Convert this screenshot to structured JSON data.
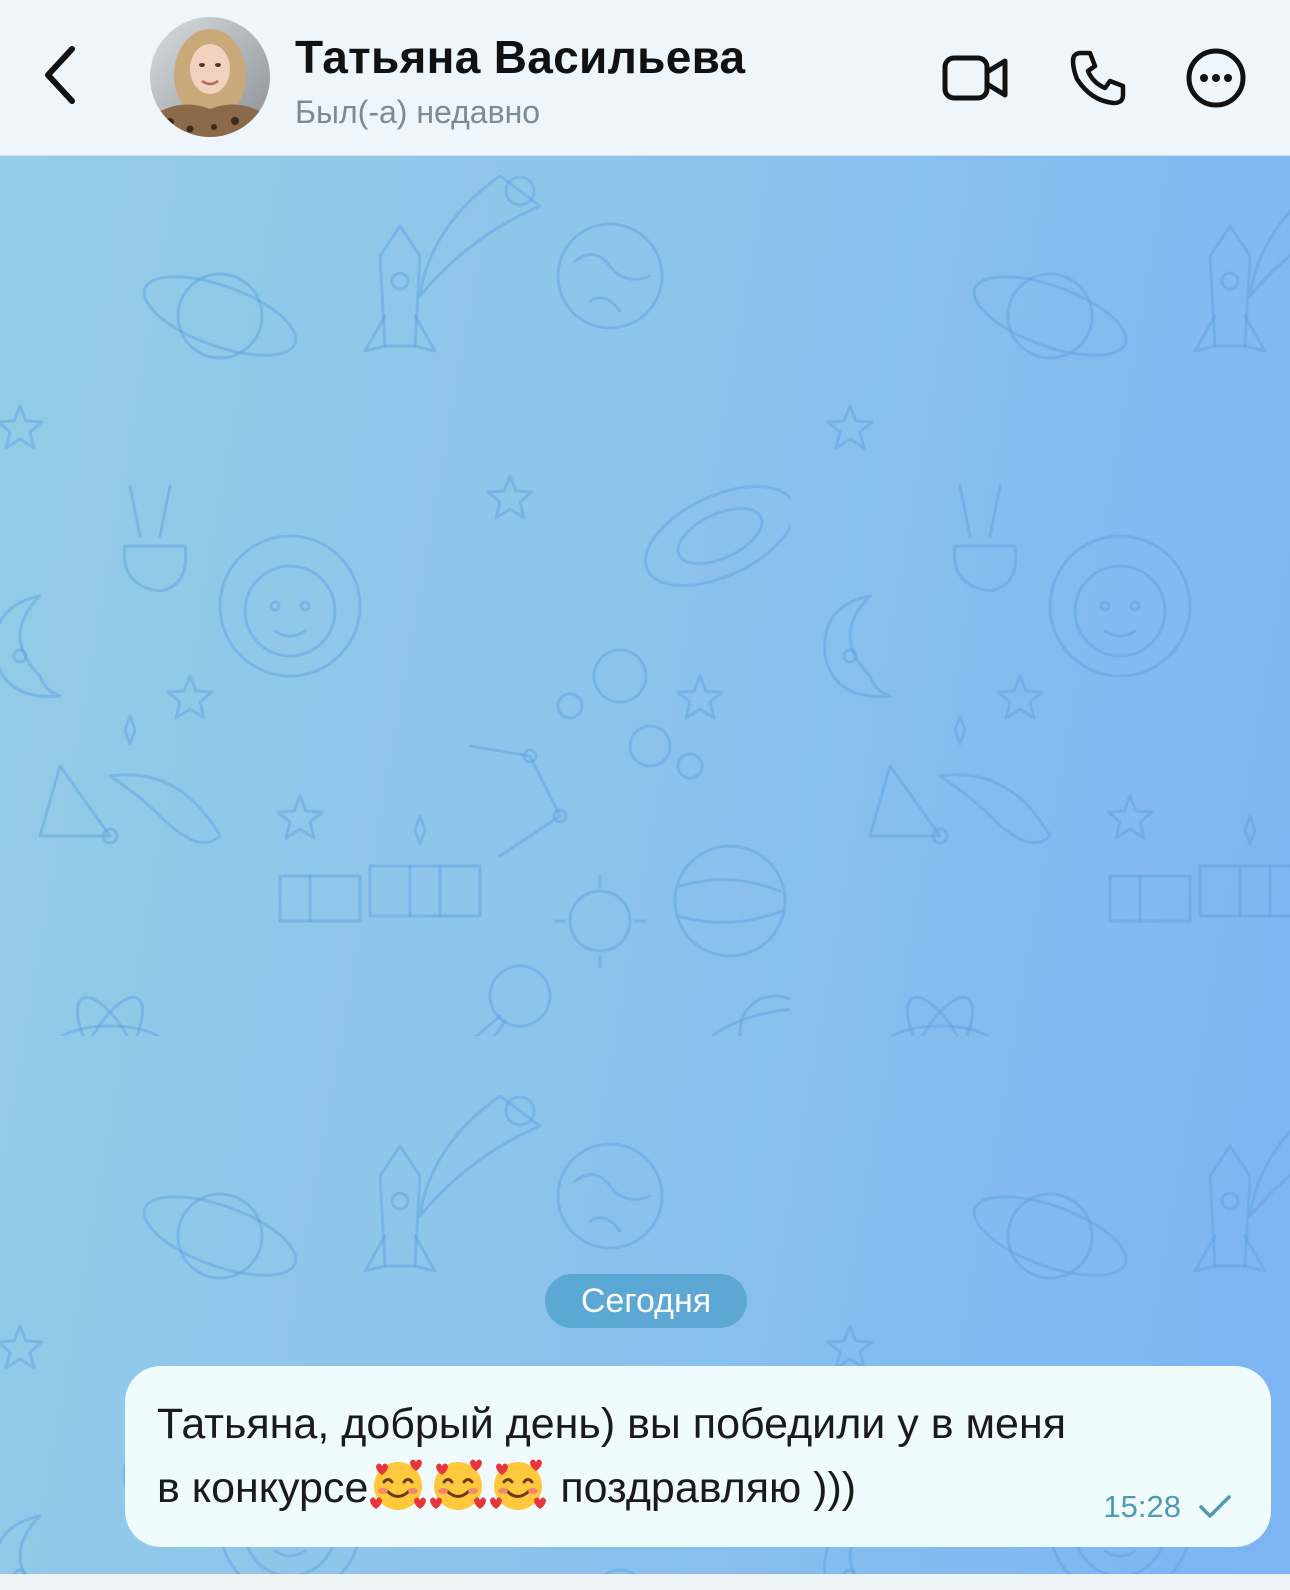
{
  "header": {
    "contact_name": "Татьяна Васильева",
    "status": "Был(-а) недавно"
  },
  "chat": {
    "date_separator": "Сегодня",
    "messages": [
      {
        "line1": "Татьяна, добрый день) вы победили у в меня",
        "line2_prefix": "в конкурсе",
        "emojis": [
          "smiling-face-with-hearts",
          "smiling-face-with-hearts",
          "smiling-face-with-hearts"
        ],
        "line2_suffix": " поздравляю )))",
        "time": "15:28",
        "status": "sent"
      }
    ]
  },
  "colors": {
    "accent": "#4e9ab3",
    "bubble": "#effbfd",
    "wallpaper_pattern": "#5a9fe0"
  }
}
